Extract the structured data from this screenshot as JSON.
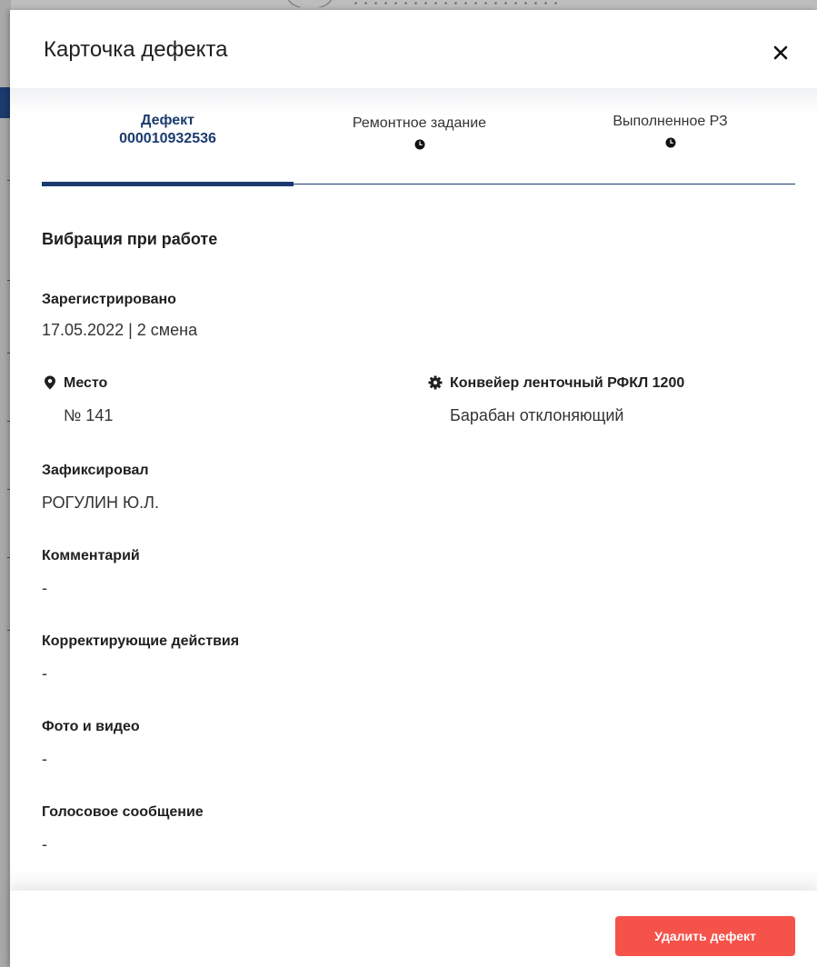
{
  "modal": {
    "title": "Карточка дефекта",
    "close_icon": "close-icon"
  },
  "tabs": [
    {
      "label": "Дефект",
      "sub": "000010932536",
      "active": true
    },
    {
      "label": "Ремонтное задание",
      "icon": "clock-icon",
      "active": false
    },
    {
      "label": "Выполненное РЗ",
      "icon": "clock-icon",
      "active": false
    }
  ],
  "defect": {
    "title": "Вибрация при работе",
    "registered_label": "Зарегистрировано",
    "registered_value": "17.05.2022 | 2 смена",
    "place_label": "Место",
    "place_icon": "map-pin-icon",
    "place_value": "№ 141",
    "equipment_label": "Конвейер ленточный РФКЛ 1200",
    "equipment_icon": "gear-icon",
    "equipment_value": "Барабан отклоняющий",
    "fixed_by_label": "Зафиксировал",
    "fixed_by_value": "РОГУЛИН Ю.Л.",
    "comment_label": "Комментарий",
    "comment_value": "-",
    "corrective_label": "Корректирующие действия",
    "corrective_value": "-",
    "media_label": "Фото и видео",
    "media_value": "-",
    "voice_label": "Голосовое сообщение",
    "voice_value": "-"
  },
  "footer": {
    "delete_label": "Удалить дефект"
  },
  "colors": {
    "accent": "#1b3b6f",
    "danger": "#f5524a"
  }
}
